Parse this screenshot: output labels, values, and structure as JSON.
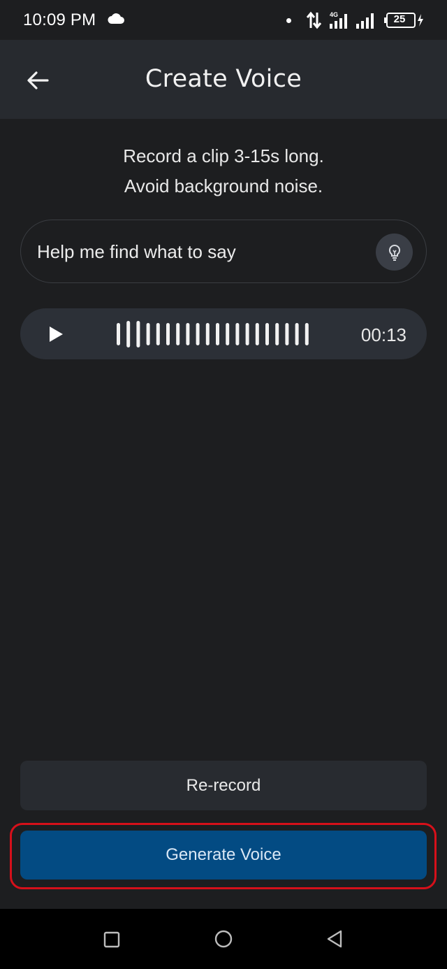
{
  "status_bar": {
    "time": "10:09 PM",
    "battery": "25",
    "network_label": "4G",
    "icons": [
      "cloud-icon",
      "dot-icon",
      "data-transfer-icon",
      "signal-4g-icon",
      "signal-icon",
      "battery-icon",
      "charging-icon"
    ]
  },
  "app_bar": {
    "title": "Create Voice",
    "back_icon": "arrow-left-icon"
  },
  "instructions": {
    "line1": "Record a clip 3-15s long.",
    "line2": "Avoid background noise."
  },
  "hint": {
    "text": "Help me find what to say",
    "icon": "lightbulb-icon"
  },
  "player": {
    "play_icon": "play-icon",
    "duration": "00:13",
    "bar_count": 20
  },
  "actions": {
    "rerecord_label": "Re-record",
    "generate_label": "Generate Voice"
  },
  "colors": {
    "background": "#1d1e20",
    "app_bar": "#272a2f",
    "player": "#2c3037",
    "primary": "#034b83",
    "highlight": "#d6101a"
  },
  "nav_bar": {
    "icons": [
      "recents-square-icon",
      "home-circle-icon",
      "back-triangle-icon"
    ]
  }
}
